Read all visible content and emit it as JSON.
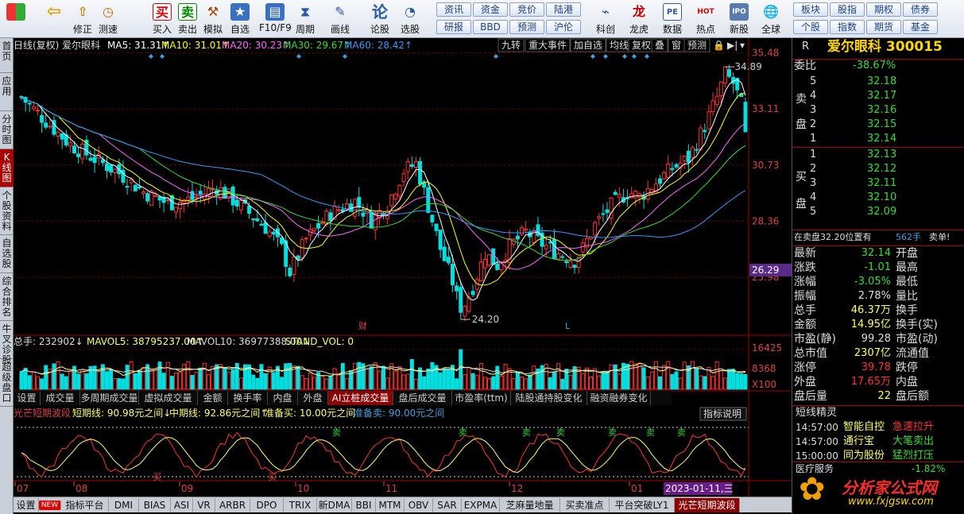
{
  "toolbar": {
    "left": [
      {
        "id": "windows",
        "icon": "windows-icon",
        "label": ""
      },
      {
        "id": "back",
        "icon": "back-arrow-icon",
        "label": ""
      },
      {
        "id": "fix",
        "icon": "fix-icon",
        "label": "修正"
      },
      {
        "id": "speed",
        "icon": "speed-test-icon",
        "label": "测速"
      },
      {
        "id": "buy",
        "icon": "buy-icon",
        "label": "买入",
        "glyph": "买"
      },
      {
        "id": "sell",
        "icon": "sell-icon",
        "label": "卖出",
        "glyph": "卖"
      },
      {
        "id": "sim",
        "icon": "hammer-icon",
        "label": "模拟"
      },
      {
        "id": "zixuan",
        "icon": "zixuan-icon",
        "label": "自选"
      },
      {
        "id": "f10",
        "icon": "f10-icon",
        "label": "F10/F9"
      },
      {
        "id": "period",
        "icon": "period-icon",
        "label": "周期"
      },
      {
        "id": "draw",
        "icon": "pencil-icon",
        "label": "画线"
      },
      {
        "id": "lunggu",
        "icon": "lungu-icon",
        "label": "论股",
        "glyph": "论"
      },
      {
        "id": "xuangu",
        "icon": "xuangu-icon",
        "label": "选股"
      }
    ],
    "grid": [
      [
        "资讯",
        "资金",
        "竞价",
        "陆港"
      ],
      [
        "研报",
        "BBD",
        "预测",
        "沪伦"
      ]
    ],
    "right": [
      {
        "id": "kechuang",
        "icon": "kechuang-icon",
        "label": "科创"
      },
      {
        "id": "longhu",
        "icon": "longhu-icon",
        "label": "龙虎"
      },
      {
        "id": "data",
        "icon": "data-icon",
        "label": "数据",
        "glyph": "PE"
      },
      {
        "id": "hot",
        "icon": "hot-icon",
        "label": "热点",
        "glyph": "HOT"
      },
      {
        "id": "ipo",
        "icon": "ipo-icon",
        "label": "新股",
        "glyph": "IPO"
      },
      {
        "id": "global",
        "icon": "globe-icon",
        "label": "全球"
      }
    ],
    "grid2": [
      [
        "板块",
        "股指",
        "期权",
        "债券"
      ],
      [
        "个股",
        "指数",
        "期货",
        "基金"
      ]
    ]
  },
  "left_tabs": [
    "首页",
    "应用",
    "分时图",
    "K线图",
    "个股资料",
    "自选股",
    "综合排名",
    "牛叉诊股",
    "超级盘口"
  ],
  "chart": {
    "header": {
      "name": "日线(复权) 爱尔眼科",
      "ma5": "MA5: 31.31↑",
      "ma10": "MA10: 31.01↑",
      "ma20": "MA20: 30.23↑",
      "ma30": "MA30: 29.67↑",
      "ma60": "MA60: 28.42↑"
    },
    "top_buttons": [
      "九转",
      "重大事件",
      "加自选",
      "均线",
      "复权",
      "叠",
      "窗",
      "预测"
    ],
    "price_axis": [
      "35.48",
      "33.11",
      "30.73",
      "28.36",
      "25.98"
    ],
    "current_price_tag": "26.29",
    "high_label": "34.89",
    "low_label": "24.20",
    "marker_cai": "财",
    "marker_l": "L",
    "volume_header": {
      "total": "总手: 232902↓",
      "mavol5": "MAVOL5: 38795237.00↑",
      "mavol10": "MAVOL10: 36977388.00↓",
      "stand": "STAND_VOL: 0"
    },
    "volume_axis": [
      "16425",
      "8368",
      "X100"
    ],
    "mid_tabs": [
      "设置",
      "成交量",
      "多周期成交量",
      "虚拟成交量",
      "金额",
      "换手率",
      "内盘",
      "外盘",
      "AI立桩成交量",
      "盘后成交量",
      "市盈率(ttm)",
      "陆股通持股变化",
      "融资融券变化"
    ],
    "indicator_header": {
      "name": "光芒短期波段",
      "short": "短期线: 90.98元之间↓",
      "mid": "中期线: 92.86元之间↑",
      "buy": "准备买: 10.00元之间",
      "sell": "准备卖: 90.00元之间"
    },
    "indicator_button": "指标说明",
    "ind_signals": {
      "buy": "买",
      "sell": "卖"
    },
    "x_axis": [
      "07",
      "08",
      "09",
      "10",
      "11",
      "12",
      "01"
    ],
    "date_highlight": "2023-01-11,三"
  },
  "chart_data": {
    "type": "candlestick",
    "title": "日线(复权) 爱尔眼科",
    "ylim": [
      24.0,
      35.5
    ],
    "x_months": [
      "07",
      "08",
      "09",
      "10",
      "11",
      "12",
      "01"
    ],
    "high": 34.89,
    "low": 24.2,
    "last_close": 32.14,
    "series": [
      {
        "name": "MA5",
        "value": 31.31
      },
      {
        "name": "MA10",
        "value": 31.01
      },
      {
        "name": "MA20",
        "value": 30.23
      },
      {
        "name": "MA30",
        "value": 29.67
      },
      {
        "name": "MA60",
        "value": 28.42
      }
    ]
  },
  "colors": {
    "up": "#ff3030",
    "down": "#00e0e0",
    "ma5": "#ffffff",
    "ma10": "#ffff00",
    "ma20": "#ff66ff",
    "ma30": "#33dd33",
    "ma60": "#3399ff",
    "grid": "#6a0000",
    "axisText": "#e04040"
  },
  "right_panel": {
    "flag": "R",
    "title": "爱尔眼科 300015",
    "weibi_label": "委比",
    "weibi": "-38.67%",
    "sell_label": "卖盘",
    "buy_label": "买盘",
    "asks": [
      [
        "5",
        "32.18"
      ],
      [
        "4",
        "32.17"
      ],
      [
        "3",
        "32.16"
      ],
      [
        "2",
        "32.15"
      ],
      [
        "1",
        "32.14"
      ]
    ],
    "bids": [
      [
        "1",
        "32.13"
      ],
      [
        "2",
        "32.12"
      ],
      [
        "3",
        "32.11"
      ],
      [
        "4",
        "32.10"
      ],
      [
        "5",
        "32.09"
      ]
    ],
    "notice": "在卖盘32.20位置有",
    "notice_qty": "562手",
    "notice_tail": "卖单!",
    "quotes": [
      [
        "最新",
        "32.14",
        "开盘"
      ],
      [
        "涨跌",
        "-1.01",
        "最高"
      ],
      [
        "涨幅",
        "-3.05%",
        "最低"
      ],
      [
        "振幅",
        "2.78%",
        "量比"
      ],
      [
        "总手",
        "46.37万",
        "换手"
      ],
      [
        "金额",
        "14.95亿",
        "换手(实)"
      ],
      [
        "市盈(静)",
        "99.28",
        "市盈(动)"
      ],
      [
        "总市值",
        "2307亿",
        "流通值"
      ],
      [
        "涨停",
        "39.78",
        "跌停"
      ],
      [
        "外盘",
        "17.65万",
        "内盘"
      ],
      [
        "盘后量",
        "22",
        "盘后额"
      ]
    ],
    "short_title": "短线精灵",
    "short_list": [
      [
        "14:57:00",
        "智能自控",
        "急速拉升"
      ],
      [
        "14:57:00",
        "通行宝",
        "大笔卖出"
      ],
      [
        "15:00:00",
        "同为股份",
        "猛烈打压"
      ]
    ],
    "cut_row_label": "医疗服务",
    "cut_row_val": "-1.82%"
  },
  "bottom_tabs": [
    "设置",
    "NEW",
    "指标平台",
    "DMI",
    "BIAS",
    "ASI",
    "VR",
    "ARBR",
    "DPO",
    "TRIX",
    "新DMA",
    "BBI",
    "MTM",
    "OBV",
    "SAR",
    "EXPMA",
    "芝麻量地量",
    "买卖准点",
    "平台突破LY1",
    "光芒短期波段"
  ],
  "watermark": {
    "main": "分析家公式网",
    "sub": "www.fxjgsw.com"
  }
}
